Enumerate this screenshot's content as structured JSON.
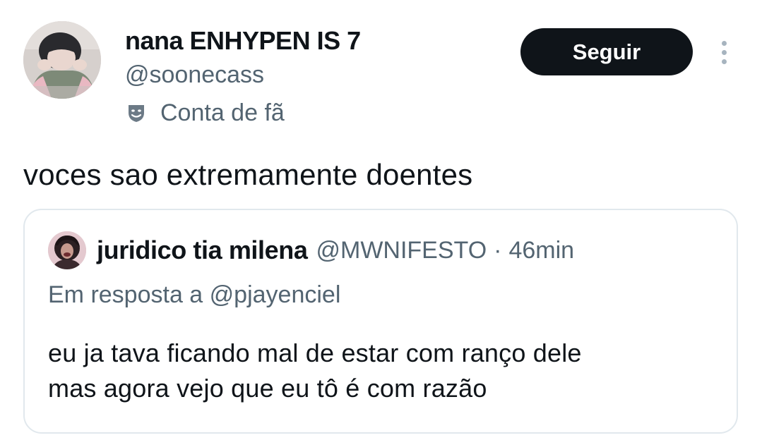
{
  "author": {
    "display_name": "nana ENHYPEN IS 7",
    "handle": "@soonecass",
    "badge_label": "Conta de fã",
    "badge_icon": "theater-masks-icon",
    "avatar": "profile-avatar"
  },
  "actions": {
    "follow_label": "Seguir",
    "more_icon": "more-options-icon"
  },
  "tweet": {
    "text": "voces sao extremamente doentes"
  },
  "quoted_tweet": {
    "display_name": "juridico tia milena",
    "handle": "@MWNIFESTO",
    "separator": "·",
    "time": "46min",
    "reply_to": "Em resposta a @pjayenciel",
    "text_lines": [
      "eu ja tava ficando mal de estar com ranço dele",
      "mas agora vejo que eu tô é com razão"
    ],
    "avatar": "quoted-avatar"
  },
  "colors": {
    "text_primary": "#0f1419",
    "text_secondary": "#536471",
    "button_bg": "#0f1419",
    "border": "#e1e8ed"
  }
}
